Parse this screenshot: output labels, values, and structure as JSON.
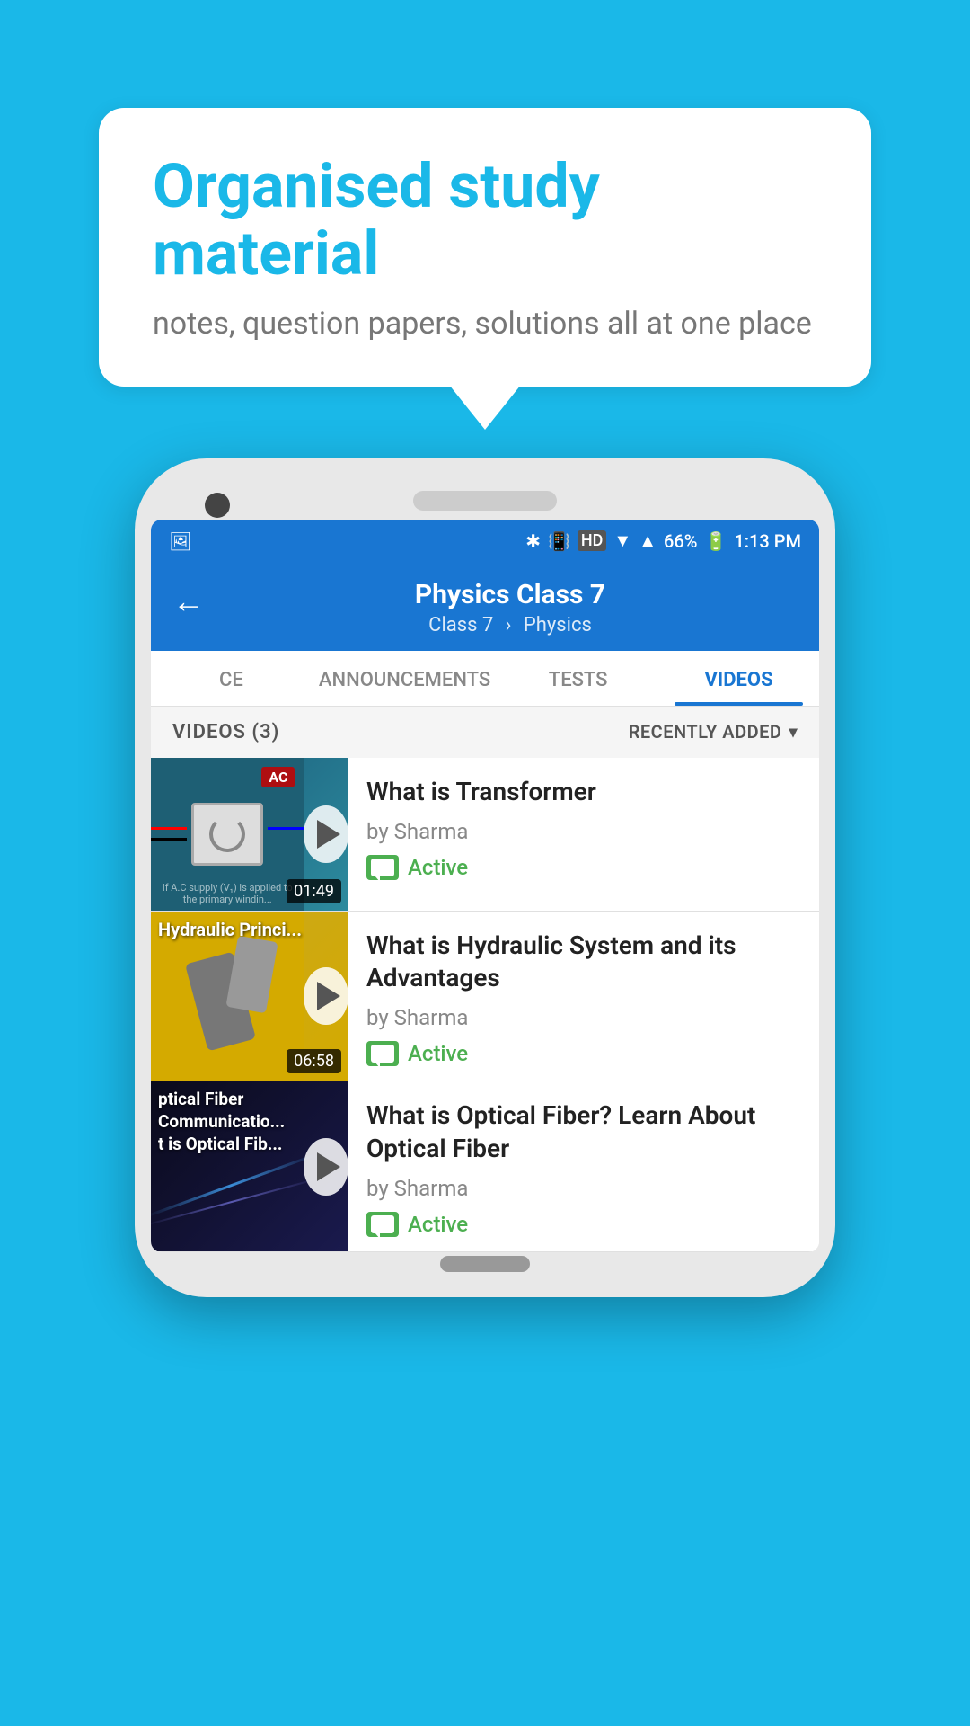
{
  "page": {
    "background_color": "#1ab8e8"
  },
  "speech_bubble": {
    "title": "Organised study material",
    "subtitle": "notes, question papers, solutions all at one place"
  },
  "status_bar": {
    "time": "1:13 PM",
    "battery": "66%",
    "signal_icons": "status icons"
  },
  "app_bar": {
    "back_label": "←",
    "title": "Physics Class 7",
    "breadcrumb_class": "Class 7",
    "breadcrumb_subject": "Physics"
  },
  "tabs": [
    {
      "label": "CE",
      "active": false
    },
    {
      "label": "ANNOUNCEMENTS",
      "active": false
    },
    {
      "label": "TESTS",
      "active": false
    },
    {
      "label": "VIDEOS",
      "active": true
    }
  ],
  "videos_section": {
    "header_count": "VIDEOS (3)",
    "sort_label": "RECENTLY ADDED"
  },
  "videos": [
    {
      "title": "What is  Transformer",
      "author": "by Sharma",
      "status": "Active",
      "duration": "01:49",
      "thumbnail_type": "transformer"
    },
    {
      "title": "What is Hydraulic System and its Advantages",
      "author": "by Sharma",
      "status": "Active",
      "duration": "06:58",
      "thumbnail_type": "hydraulic"
    },
    {
      "title": "What is Optical Fiber? Learn About Optical Fiber",
      "author": "by Sharma",
      "status": "Active",
      "duration": "",
      "thumbnail_type": "optical"
    }
  ]
}
